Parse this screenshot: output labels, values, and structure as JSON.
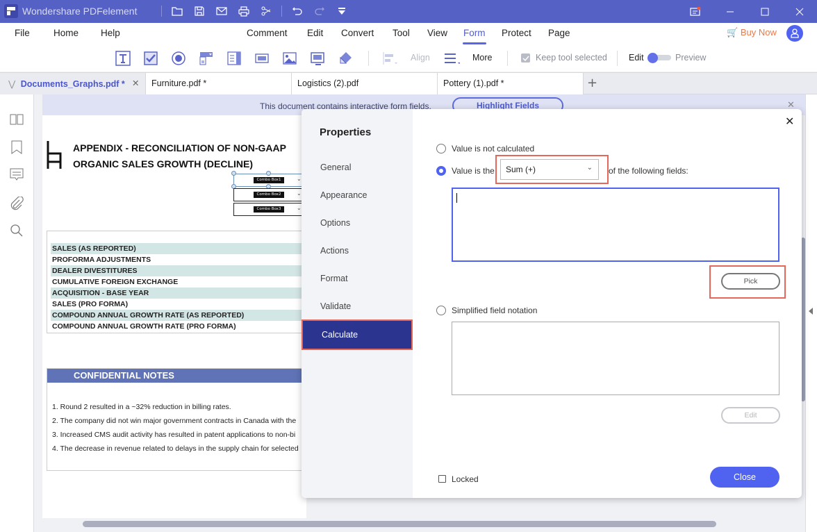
{
  "app": {
    "title": "Wondershare PDFelement"
  },
  "titlebar": {
    "icons": [
      "open-folder-icon",
      "save-icon",
      "email-icon",
      "print-icon",
      "cut-icon",
      "undo-icon",
      "redo-icon",
      "quick-access-dropdown-icon"
    ]
  },
  "menu": {
    "left": [
      "File",
      "Home",
      "Help"
    ],
    "center": [
      "Comment",
      "Edit",
      "Convert",
      "Tool",
      "View",
      "Form",
      "Protect",
      "Page"
    ],
    "active": "Form",
    "buy_now": "Buy Now"
  },
  "toolbar": {
    "tools": [
      "text-field",
      "check-box",
      "radio-button",
      "combo-box",
      "list-box",
      "button",
      "image-field",
      "signature-field",
      "eraser"
    ],
    "align_label": "Align",
    "more_label": "More",
    "keep_tool_selected": "Keep tool selected",
    "keep_tool_checked": true,
    "edit_label": "Edit",
    "preview_label": "Preview",
    "mode": "Edit"
  },
  "tabs": [
    {
      "label": "Documents_Graphs.pdf *",
      "active": true
    },
    {
      "label": "Furniture.pdf *",
      "active": false
    },
    {
      "label": "Logistics (2).pdf",
      "active": false
    },
    {
      "label": "Pottery (1).pdf *",
      "active": false
    }
  ],
  "banner": {
    "text": "This document contains interactive form fields.",
    "button": "Highlight Fields"
  },
  "document": {
    "title_line1": "APPENDIX - RECONCILIATION OF NON-GAAP",
    "title_line2": "ORGANIC SALES GROWTH (DECLINE)",
    "combo_boxes": [
      "Combo Box1",
      "Combo Box2",
      "Combo Box3"
    ],
    "table_rows": [
      "SALES (AS REPORTED)",
      "PROFORMA ADJUSTMENTS",
      "DEALER DIVESTITURES",
      "CUMULATIVE FOREIGN EXCHANGE",
      "ACQUISITION - BASE YEAR",
      "SALES (PRO FORMA)",
      "COMPOUND ANNUAL GROWTH RATE (AS REPORTED)",
      "COMPOUND ANNUAL GROWTH RATE (PRO FORMA)"
    ],
    "notes_header": "CONFIDENTIAL NOTES",
    "notes": [
      "1. Round 2 resulted in a ~32% reduction in billing rates.",
      "2. The company did not win major government contracts in Canada with the",
      "3. Increased CMS audit activity has resulted in patent applications to non-bi",
      "4. The decrease in revenue related to delays in the supply chain for selected"
    ]
  },
  "dialog": {
    "heading": "Properties",
    "nav": [
      "General",
      "Appearance",
      "Options",
      "Actions",
      "Format",
      "Validate",
      "Calculate"
    ],
    "active_nav": "Calculate",
    "option_not_calculated": "Value is not calculated",
    "option_value_is_the": "Value is the",
    "option_of_following": "of the following fields:",
    "selected_option": "value-is-the",
    "operation": "Sum (+)",
    "fields_value": "",
    "pick_label": "Pick",
    "option_simplified": "Simplified field notation",
    "notation_value": "",
    "edit_label": "Edit",
    "locked_label": "Locked",
    "locked": false,
    "close_label": "Close"
  },
  "colors": {
    "titlebar": "#5661c6",
    "accent": "#4f63f0",
    "active_nav": "#2b3590",
    "highlight_red": "#e4675a",
    "buy_now": "#e67a4c"
  }
}
